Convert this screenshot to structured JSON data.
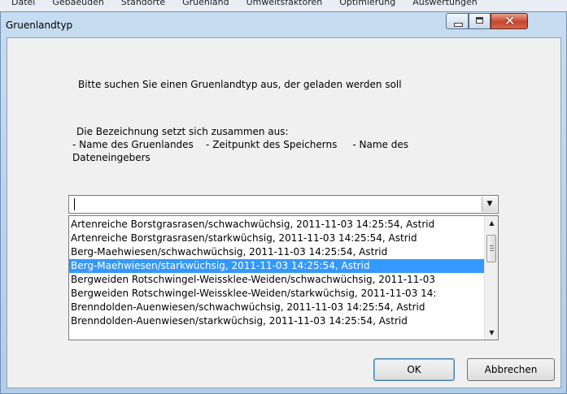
{
  "window": {
    "title": "Gruenlandtyp",
    "controls": {
      "minimize": "minimize",
      "maximize": "maximize",
      "close": "close"
    }
  },
  "dialog": {
    "instruction": "Bitte suchen Sie einen Gruenlandtyp aus, der geladen werden soll",
    "composition_heading": "Die Bezeichnung setzt sich zusammen aus:",
    "composition_line1": "- Name des Gruenlandes    - Zeitpunkt des Speicherns     - Name des",
    "composition_line2": "Dateneingebers"
  },
  "combo": {
    "value": ""
  },
  "list": {
    "selected_index": 3,
    "items": [
      "Artenreiche Borstgrasrasen/schwachwüchsig, 2011-11-03 14:25:54, Astrid",
      "Artenreiche Borstgrasrasen/starkwüchsig, 2011-11-03 14:25:54, Astrid",
      "Berg-Maehwiesen/schwachwüchsig, 2011-11-03 14:25:54, Astrid",
      "Berg-Maehwiesen/starkwüchsig, 2011-11-03 14:25:54, Astrid",
      "Bergweiden Rotschwingel-Weissklee-Weiden/schwachwüchsig, 2011-11-03",
      "Bergweiden Rotschwingel-Weissklee-Weiden/starkwüchsig, 2011-11-03 14:",
      "Brenndolden-Auenwiesen/schwachwüchsig, 2011-11-03 14:25:54, Astrid",
      "Brenndolden-Auenwiesen/starkwüchsig, 2011-11-03 14:25:54, Astrid"
    ]
  },
  "buttons": {
    "ok": "OK",
    "cancel": "Abbrechen"
  },
  "colors": {
    "selection": "#3399ff",
    "close_button": "#c8452c"
  }
}
